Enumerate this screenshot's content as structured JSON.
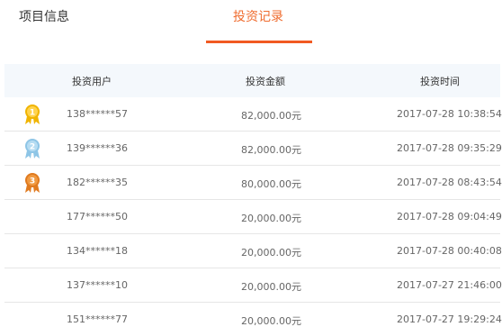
{
  "tabs": [
    {
      "label": "项目信息",
      "active": false
    },
    {
      "label": "投资记录",
      "active": true
    }
  ],
  "colors": {
    "accent": "#f15a22",
    "gold": "#f0b400",
    "silver": "#8ec5e6",
    "bronze": "#e07a1f",
    "header_bg": "#f4f8fc"
  },
  "table": {
    "headers": [
      "投资用户",
      "投资金额",
      "投资时间"
    ],
    "rows": [
      {
        "medal": "1",
        "user": "138******57",
        "amount": "82,000.00元",
        "time": "2017-07-28 10:38:54"
      },
      {
        "medal": "2",
        "user": "139******36",
        "amount": "82,000.00元",
        "time": "2017-07-28 09:35:29"
      },
      {
        "medal": "3",
        "user": "182******35",
        "amount": "80,000.00元",
        "time": "2017-07-28 08:43:54"
      },
      {
        "medal": "",
        "user": "177******50",
        "amount": "20,000.00元",
        "time": "2017-07-28 09:04:49"
      },
      {
        "medal": "",
        "user": "134******18",
        "amount": "20,000.00元",
        "time": "2017-07-28 00:40:08"
      },
      {
        "medal": "",
        "user": "137******10",
        "amount": "20,000.00元",
        "time": "2017-07-27 21:46:00"
      },
      {
        "medal": "",
        "user": "151******77",
        "amount": "20,000.00元",
        "time": "2017-07-27 19:29:24"
      }
    ]
  }
}
